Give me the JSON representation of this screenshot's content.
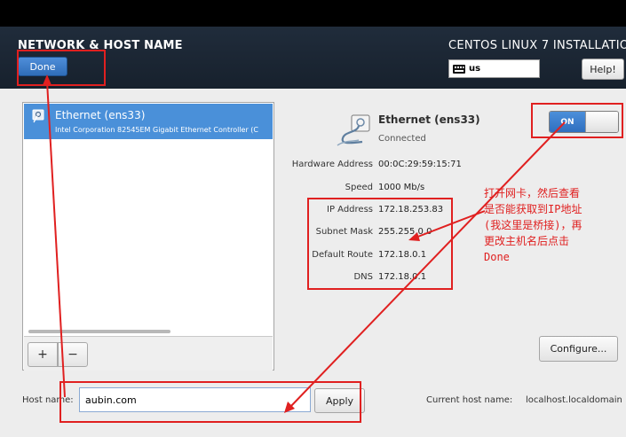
{
  "header": {
    "title": "NETWORK & HOST NAME",
    "done_label": "Done",
    "product": "CENTOS LINUX 7 INSTALLATIO",
    "keyboard_layout": "us",
    "help_label": "Help!"
  },
  "device_list": {
    "items": [
      {
        "name": "Ethernet (ens33)",
        "description": "Intel Corporation 82545EM Gigabit Ethernet Controller (C"
      }
    ],
    "add_label": "+",
    "remove_label": "−"
  },
  "details": {
    "name": "Ethernet (ens33)",
    "status": "Connected",
    "toggle_label": "ON",
    "properties": [
      {
        "label": "Hardware Address",
        "value": "00:0C:29:59:15:71"
      },
      {
        "label": "Speed",
        "value": "1000 Mb/s"
      },
      {
        "label": "IP Address",
        "value": "172.18.253.83"
      },
      {
        "label": "Subnet Mask",
        "value": "255.255.0.0"
      },
      {
        "label": "Default Route",
        "value": "172.18.0.1"
      },
      {
        "label": "DNS",
        "value": "172.18.0.1"
      }
    ],
    "configure_label": "Configure..."
  },
  "hostname": {
    "label": "Host name:",
    "value": "aubin.com",
    "apply_label": "Apply",
    "current_label": "Current host name:",
    "current_value": "localhost.localdomain"
  },
  "annotation": {
    "color": "#e02020",
    "lines": [
      "打开网卡，然后查看",
      "是否能获取到IP地址",
      "(我这里是桥接)，再",
      "更改主机名后点击",
      "Done"
    ]
  }
}
